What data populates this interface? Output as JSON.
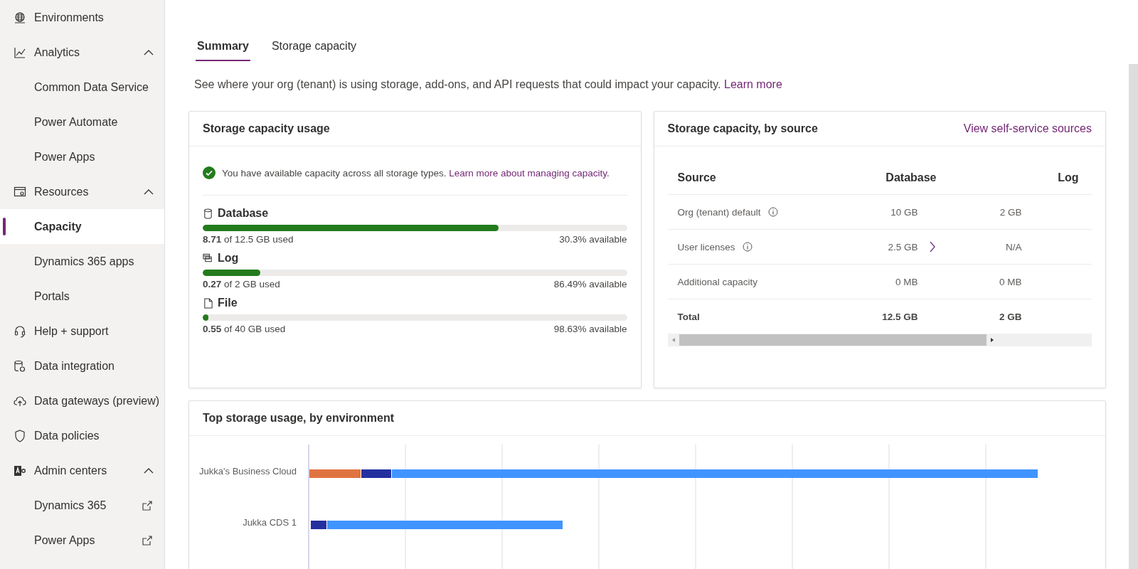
{
  "sidebar": {
    "items": [
      {
        "label": "Environments",
        "selected": false
      },
      {
        "label": "Analytics",
        "selected": false,
        "expanded": true,
        "children": [
          {
            "label": "Common Data Service",
            "selected": false,
            "external": false
          },
          {
            "label": "Power Automate",
            "selected": false,
            "external": false
          },
          {
            "label": "Power Apps",
            "selected": false,
            "external": false
          }
        ]
      },
      {
        "label": "Resources",
        "selected": false,
        "expanded": true,
        "children": [
          {
            "label": "Capacity",
            "selected": true,
            "external": false
          },
          {
            "label": "Dynamics 365 apps",
            "selected": false,
            "external": false
          },
          {
            "label": "Portals",
            "selected": false,
            "external": false
          }
        ]
      },
      {
        "label": "Help + support",
        "selected": false
      },
      {
        "label": "Data integration",
        "selected": false
      },
      {
        "label": "Data gateways (preview)",
        "selected": false
      },
      {
        "label": "Data policies",
        "selected": false
      },
      {
        "label": "Admin centers",
        "selected": false,
        "expanded": true,
        "children": [
          {
            "label": "Dynamics 365",
            "selected": false,
            "external": true
          },
          {
            "label": "Power Apps",
            "selected": false,
            "external": true
          }
        ]
      }
    ]
  },
  "tabs": [
    {
      "label": "Summary",
      "selected": true
    },
    {
      "label": "Storage capacity",
      "selected": false
    }
  ],
  "intro": {
    "text": "See where your org (tenant) is using storage, add-ons, and API requests that could impact your capacity.",
    "link": "Learn more"
  },
  "usage_card": {
    "title": "Storage capacity usage",
    "notice": {
      "text": "You have available capacity across all storage types.",
      "link": "Learn more about managing capacity."
    },
    "storage": [
      {
        "name": "Database",
        "level": 0.697,
        "used": "8.71",
        "of": "of 12.5 GB used",
        "available": "30.3% available"
      },
      {
        "name": "Log",
        "level": 0.135,
        "used": "0.27",
        "of": "of 2 GB used",
        "available": "86.49% available"
      },
      {
        "name": "File",
        "level": 0.014,
        "used": "0.55",
        "of": "of 40 GB used",
        "available": "98.63% available"
      }
    ]
  },
  "source_card": {
    "title": "Storage capacity, by source",
    "link": "View self-service sources",
    "table": {
      "columns": [
        "Source",
        "Database",
        "Log"
      ],
      "rows": [
        {
          "kind": "item",
          "cells": [
            "Org (tenant) default",
            "10 GB",
            "2 GB"
          ],
          "info": true,
          "arrow": false
        },
        {
          "kind": "item",
          "cells": [
            "User licenses",
            "2.5 GB",
            "N/A"
          ],
          "info": true,
          "arrow": true
        },
        {
          "kind": "item",
          "cells": [
            "Additional capacity",
            "0 MB",
            "0 MB"
          ],
          "info": false,
          "arrow": false
        },
        {
          "kind": "total",
          "cells": [
            "Total",
            "12.5 GB",
            "2 GB"
          ],
          "info": false,
          "arrow": false
        }
      ]
    }
  },
  "environment_card": {
    "title": "Top storage usage, by environment",
    "categories": [
      "Jukka's Business Cloud",
      "Jukka CDS 1"
    ]
  }
}
